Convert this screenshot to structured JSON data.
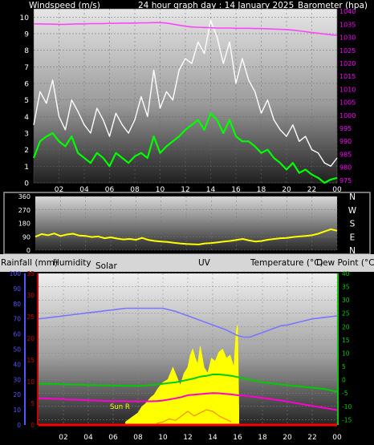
{
  "header": {
    "left_label": "Windspeed (m/s)",
    "title": "24 hour graph day : 14 January 2025",
    "right_label": "Barometer (hpa)"
  },
  "colors": {
    "wind_avg": "#00ff00",
    "wind_gust": "#ffffff",
    "barometer": "#ff44ff",
    "direction": "#ffff00",
    "temperature": "#00cc00",
    "dew_point": "#ff00cc",
    "humidity": "#7777ff",
    "solar": "#ffff00",
    "uv": "#ff8800",
    "rain": "#ff0000",
    "rain_axis": "#cc0000",
    "humidity_axis": "#5555ff",
    "temp_axis": "#00cc00",
    "baro_axis": "#ff00ff"
  },
  "chart_data": [
    {
      "type": "line",
      "panel": "wind",
      "x_ticks": [
        "02",
        "04",
        "06",
        "08",
        "10",
        "12",
        "14",
        "16",
        "18",
        "20",
        "22",
        "00"
      ],
      "xlim": [
        0,
        24
      ],
      "y_left_ticks": [
        "0",
        "1",
        "2",
        "3",
        "4",
        "5",
        "6",
        "7",
        "8",
        "9",
        "10"
      ],
      "ylim_left": [
        0,
        10.5
      ],
      "y_right_ticks": [
        "975",
        "980",
        "985",
        "990",
        "995",
        "1000",
        "1005",
        "1010",
        "1015",
        "1020",
        "1025",
        "1030",
        "1035",
        "1040"
      ],
      "ylim_right": [
        974,
        1041
      ],
      "x": [
        0,
        0.5,
        1,
        1.5,
        2,
        2.5,
        3,
        3.5,
        4,
        4.5,
        5,
        5.5,
        6,
        6.5,
        7,
        7.5,
        8,
        8.5,
        9,
        9.5,
        10,
        10.5,
        11,
        11.5,
        12,
        12.5,
        13,
        13.5,
        14,
        14.5,
        15,
        15.5,
        16,
        16.5,
        17,
        17.5,
        18,
        18.5,
        19,
        19.5,
        20,
        20.5,
        21,
        21.5,
        22,
        22.5,
        23,
        23.5,
        24
      ],
      "series": [
        {
          "name": "Wind gust",
          "axis": "left",
          "values": [
            3.5,
            5.5,
            4.8,
            6.2,
            4.0,
            3.2,
            5.0,
            4.3,
            3.5,
            3.0,
            4.5,
            3.8,
            2.8,
            4.2,
            3.5,
            3.0,
            3.8,
            5.2,
            4.0,
            6.8,
            4.5,
            5.5,
            5.0,
            6.8,
            7.5,
            7.2,
            8.5,
            7.8,
            9.8,
            8.8,
            7.2,
            8.5,
            6.0,
            7.5,
            6.2,
            5.5,
            4.2,
            5.0,
            3.8,
            3.2,
            2.8,
            3.5,
            2.5,
            2.8,
            2.0,
            1.8,
            1.2,
            1.0,
            1.5
          ]
        },
        {
          "name": "Wind speed",
          "axis": "left",
          "values": [
            1.5,
            2.5,
            2.8,
            3.0,
            2.5,
            2.2,
            2.8,
            1.8,
            1.5,
            1.2,
            1.8,
            1.5,
            1.0,
            1.8,
            1.5,
            1.2,
            1.6,
            1.8,
            1.5,
            2.8,
            1.8,
            2.2,
            2.5,
            2.8,
            3.2,
            3.5,
            3.8,
            3.2,
            4.2,
            3.8,
            3.0,
            3.8,
            2.8,
            2.5,
            2.5,
            2.2,
            1.8,
            2.0,
            1.5,
            1.2,
            0.8,
            1.2,
            0.6,
            0.8,
            0.5,
            0.3,
            0.0,
            0.2,
            0.3
          ]
        },
        {
          "name": "Barometer",
          "axis": "right",
          "values": [
            1035.2,
            1035.2,
            1035.1,
            1035.1,
            1035.0,
            1035.0,
            1035.1,
            1035.2,
            1035.2,
            1035.3,
            1035.3,
            1035.3,
            1035.4,
            1035.4,
            1035.5,
            1035.5,
            1035.5,
            1035.6,
            1035.6,
            1035.7,
            1035.7,
            1035.5,
            1035.1,
            1034.7,
            1034.3,
            1034.0,
            1033.9,
            1033.8,
            1033.7,
            1033.6,
            1033.6,
            1033.6,
            1033.5,
            1033.5,
            1033.5,
            1033.4,
            1033.4,
            1033.3,
            1033.2,
            1033.1,
            1033.0,
            1032.8,
            1032.5,
            1032.2,
            1031.9,
            1031.6,
            1031.3,
            1031.0,
            1030.8
          ]
        }
      ]
    },
    {
      "type": "line",
      "panel": "direction",
      "y_ticks": [
        "0",
        "90",
        "180",
        "270",
        "360"
      ],
      "ylim": [
        0,
        360
      ],
      "compass_labels": [
        "N",
        "W",
        "S",
        "E",
        "N"
      ],
      "x": [
        0,
        0.5,
        1,
        1.5,
        2,
        2.5,
        3,
        3.5,
        4,
        4.5,
        5,
        5.5,
        6,
        6.5,
        7,
        7.5,
        8,
        8.5,
        9,
        9.5,
        10,
        10.5,
        11,
        11.5,
        12,
        12.5,
        13,
        13.5,
        14,
        14.5,
        15,
        15.5,
        16,
        16.5,
        17,
        17.5,
        18,
        18.5,
        19,
        19.5,
        20,
        20.5,
        21,
        21.5,
        22,
        22.5,
        23,
        23.5,
        24
      ],
      "series": [
        {
          "name": "Wind direction",
          "values": [
            90,
            108,
            100,
            112,
            95,
            105,
            110,
            98,
            95,
            88,
            92,
            80,
            86,
            78,
            72,
            75,
            70,
            82,
            68,
            62,
            58,
            55,
            50,
            45,
            42,
            40,
            38,
            45,
            48,
            52,
            58,
            62,
            68,
            75,
            65,
            58,
            62,
            70,
            75,
            80,
            82,
            88,
            92,
            95,
            100,
            110,
            125,
            140,
            130
          ]
        }
      ]
    },
    {
      "type": "line",
      "panel": "temperature",
      "header_labels": {
        "rain": "Rainfall (mm)",
        "humidity": "Humidity",
        "solar": "Solar",
        "uv": "UV",
        "temperature": "Temperature (°C)",
        "dew_point": "Dew Point (°C)"
      },
      "humidity_ticks": [
        "0",
        "10",
        "20",
        "30",
        "40",
        "50",
        "60",
        "70",
        "80",
        "90",
        "100"
      ],
      "rain_ticks": [
        "0",
        "5",
        "10",
        "15",
        "20",
        "25",
        "30",
        "35"
      ],
      "temp_ticks": [
        "-15",
        "-10",
        "-5",
        "0",
        "5",
        "10",
        "15",
        "20",
        "25",
        "30",
        "35",
        "40"
      ],
      "ylim_humidity": [
        0,
        100
      ],
      "ylim_rain": [
        0,
        35
      ],
      "ylim_temp": [
        -17,
        40
      ],
      "sun_label": "Sun R",
      "x": [
        0,
        0.5,
        1,
        1.5,
        2,
        2.5,
        3,
        3.5,
        4,
        4.5,
        5,
        5.5,
        6,
        6.5,
        7,
        7.5,
        8,
        8.5,
        9,
        9.5,
        10,
        10.5,
        11,
        11.5,
        12,
        12.5,
        13,
        13.5,
        14,
        14.5,
        15,
        15.5,
        16,
        16.5,
        17,
        17.5,
        18,
        18.5,
        19,
        19.5,
        20,
        20.5,
        21,
        21.5,
        22,
        22.5,
        23,
        23.5,
        24
      ],
      "series": [
        {
          "name": "Humidity",
          "axis": "humidity",
          "values": [
            70,
            70.5,
            71,
            71.5,
            72,
            72.5,
            73,
            73.5,
            74,
            74.5,
            75,
            75.5,
            76,
            76.5,
            77,
            77,
            77,
            77,
            77,
            77,
            77,
            76,
            75,
            73.5,
            72,
            70.5,
            69,
            67.5,
            66,
            64.5,
            63,
            61,
            59,
            58,
            58,
            59.5,
            61,
            62.5,
            64,
            65.5,
            66,
            67,
            68,
            69,
            70,
            70.5,
            71,
            71.5,
            72
          ]
        },
        {
          "name": "Temperature",
          "axis": "temp",
          "values": [
            -1.5,
            -1.5,
            -1.5,
            -1.6,
            -1.7,
            -1.8,
            -1.8,
            -1.9,
            -2.0,
            -2.0,
            -2.1,
            -2.1,
            -2.2,
            -2.2,
            -2.3,
            -2.3,
            -2.3,
            -2.2,
            -2.0,
            -1.8,
            -1.5,
            -1.2,
            -1.0,
            -0.5,
            0.0,
            0.5,
            1.2,
            1.5,
            2.0,
            2.0,
            1.8,
            1.5,
            1.0,
            0.5,
            0.0,
            -0.5,
            -1.0,
            -1.2,
            -1.5,
            -1.8,
            -2.0,
            -2.3,
            -2.5,
            -2.8,
            -3.0,
            -3.2,
            -3.5,
            -4.0,
            -4.5
          ]
        },
        {
          "name": "Dew Point",
          "axis": "temp",
          "values": [
            -7.0,
            -7.0,
            -7.1,
            -7.2,
            -7.3,
            -7.4,
            -7.5,
            -7.6,
            -7.7,
            -7.8,
            -7.9,
            -8.0,
            -8.0,
            -8.0,
            -8.0,
            -8.1,
            -8.1,
            -8.1,
            -8.1,
            -8.0,
            -7.8,
            -7.4,
            -7.0,
            -6.5,
            -5.8,
            -5.6,
            -5.4,
            -5.2,
            -5.0,
            -5.1,
            -5.3,
            -5.5,
            -5.8,
            -6.0,
            -6.2,
            -6.5,
            -6.8,
            -7.1,
            -7.5,
            -7.8,
            -8.2,
            -8.6,
            -9.0,
            -9.4,
            -9.8,
            -10.2,
            -10.6,
            -11.0,
            -11.4
          ]
        },
        {
          "name": "Solar",
          "axis": "humidity",
          "x": [
            7.0,
            7.5,
            8.0,
            8.3,
            8.6,
            9.0,
            9.3,
            9.6,
            10.0,
            10.4,
            10.8,
            11.1,
            11.4,
            11.7,
            12.0,
            12.2,
            12.4,
            12.6,
            12.8,
            13.0,
            13.3,
            13.6,
            13.9,
            14.2,
            14.5,
            14.8,
            15.1,
            15.4,
            15.7,
            15.9,
            16.0,
            16.1
          ],
          "values": [
            2,
            5,
            8,
            12,
            14,
            18,
            20,
            24,
            28,
            30,
            38,
            32,
            26,
            34,
            38,
            46,
            50,
            44,
            40,
            52,
            38,
            34,
            44,
            42,
            48,
            50,
            44,
            46,
            38,
            62,
            66,
            10
          ]
        },
        {
          "name": "UV",
          "axis": "humidity",
          "x": [
            9.5,
            10.0,
            10.5,
            11.0,
            11.5,
            12.0,
            12.5,
            13.0,
            13.5,
            14.0,
            14.5,
            15.0,
            15.5
          ],
          "values": [
            1,
            2,
            4,
            3,
            6,
            9,
            6,
            8,
            10,
            9,
            6,
            4,
            2
          ]
        },
        {
          "name": "Rainfall",
          "axis": "rain",
          "values": [
            0,
            0,
            0,
            0,
            0,
            0,
            0,
            0,
            0,
            0,
            0,
            0,
            0,
            0,
            0,
            0,
            0,
            0,
            0,
            0,
            0,
            0,
            0,
            0,
            0,
            0,
            0,
            0,
            0,
            0,
            0,
            0,
            0,
            0,
            0,
            0,
            0,
            0,
            0,
            0,
            0,
            0,
            0,
            0,
            0,
            0,
            0,
            0,
            0
          ]
        }
      ]
    }
  ]
}
